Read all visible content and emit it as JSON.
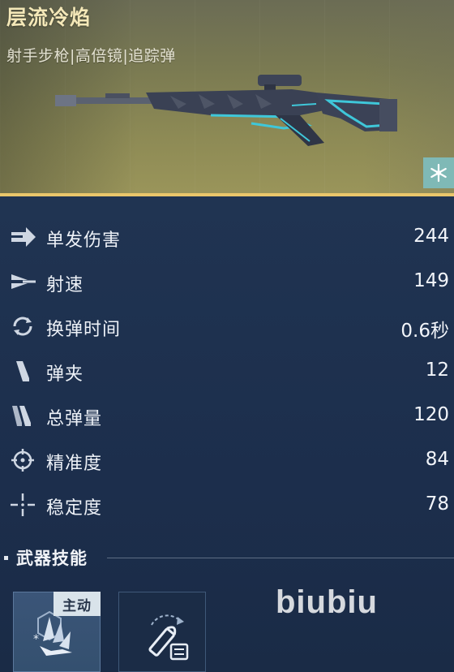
{
  "weapon": {
    "name": "层流冷焰",
    "tags": "射手步枪|高倍镜|追踪弹",
    "image_icon": "sniper-rifle-image",
    "rarity_icon": "snowflake-icon"
  },
  "colors": {
    "accent": "#e9c66b",
    "panel": "#1f3151",
    "weapon_glow": "#3fc7d9",
    "rarity": "#7fb9b6"
  },
  "stats": [
    {
      "icon": "damage-arrow-icon",
      "label": "单发伤害",
      "value": "244"
    },
    {
      "icon": "fire-rate-icon",
      "label": "射速",
      "value": "149"
    },
    {
      "icon": "reload-icon",
      "label": "换弹时间",
      "value": "0.6秒"
    },
    {
      "icon": "magazine-icon",
      "label": "弹夹",
      "value": "12"
    },
    {
      "icon": "total-ammo-icon",
      "label": "总弹量",
      "value": "120"
    },
    {
      "icon": "accuracy-crosshair-icon",
      "label": "精准度",
      "value": "84"
    },
    {
      "icon": "stability-crosshair-icon",
      "label": "稳定度",
      "value": "78"
    }
  ],
  "skills": {
    "title": "武器技能",
    "active_badge": "主动",
    "active_icon": "ice-shard-skill-icon",
    "passive_icon": "bullet-reload-skill-icon"
  },
  "watermark": "biubiu"
}
